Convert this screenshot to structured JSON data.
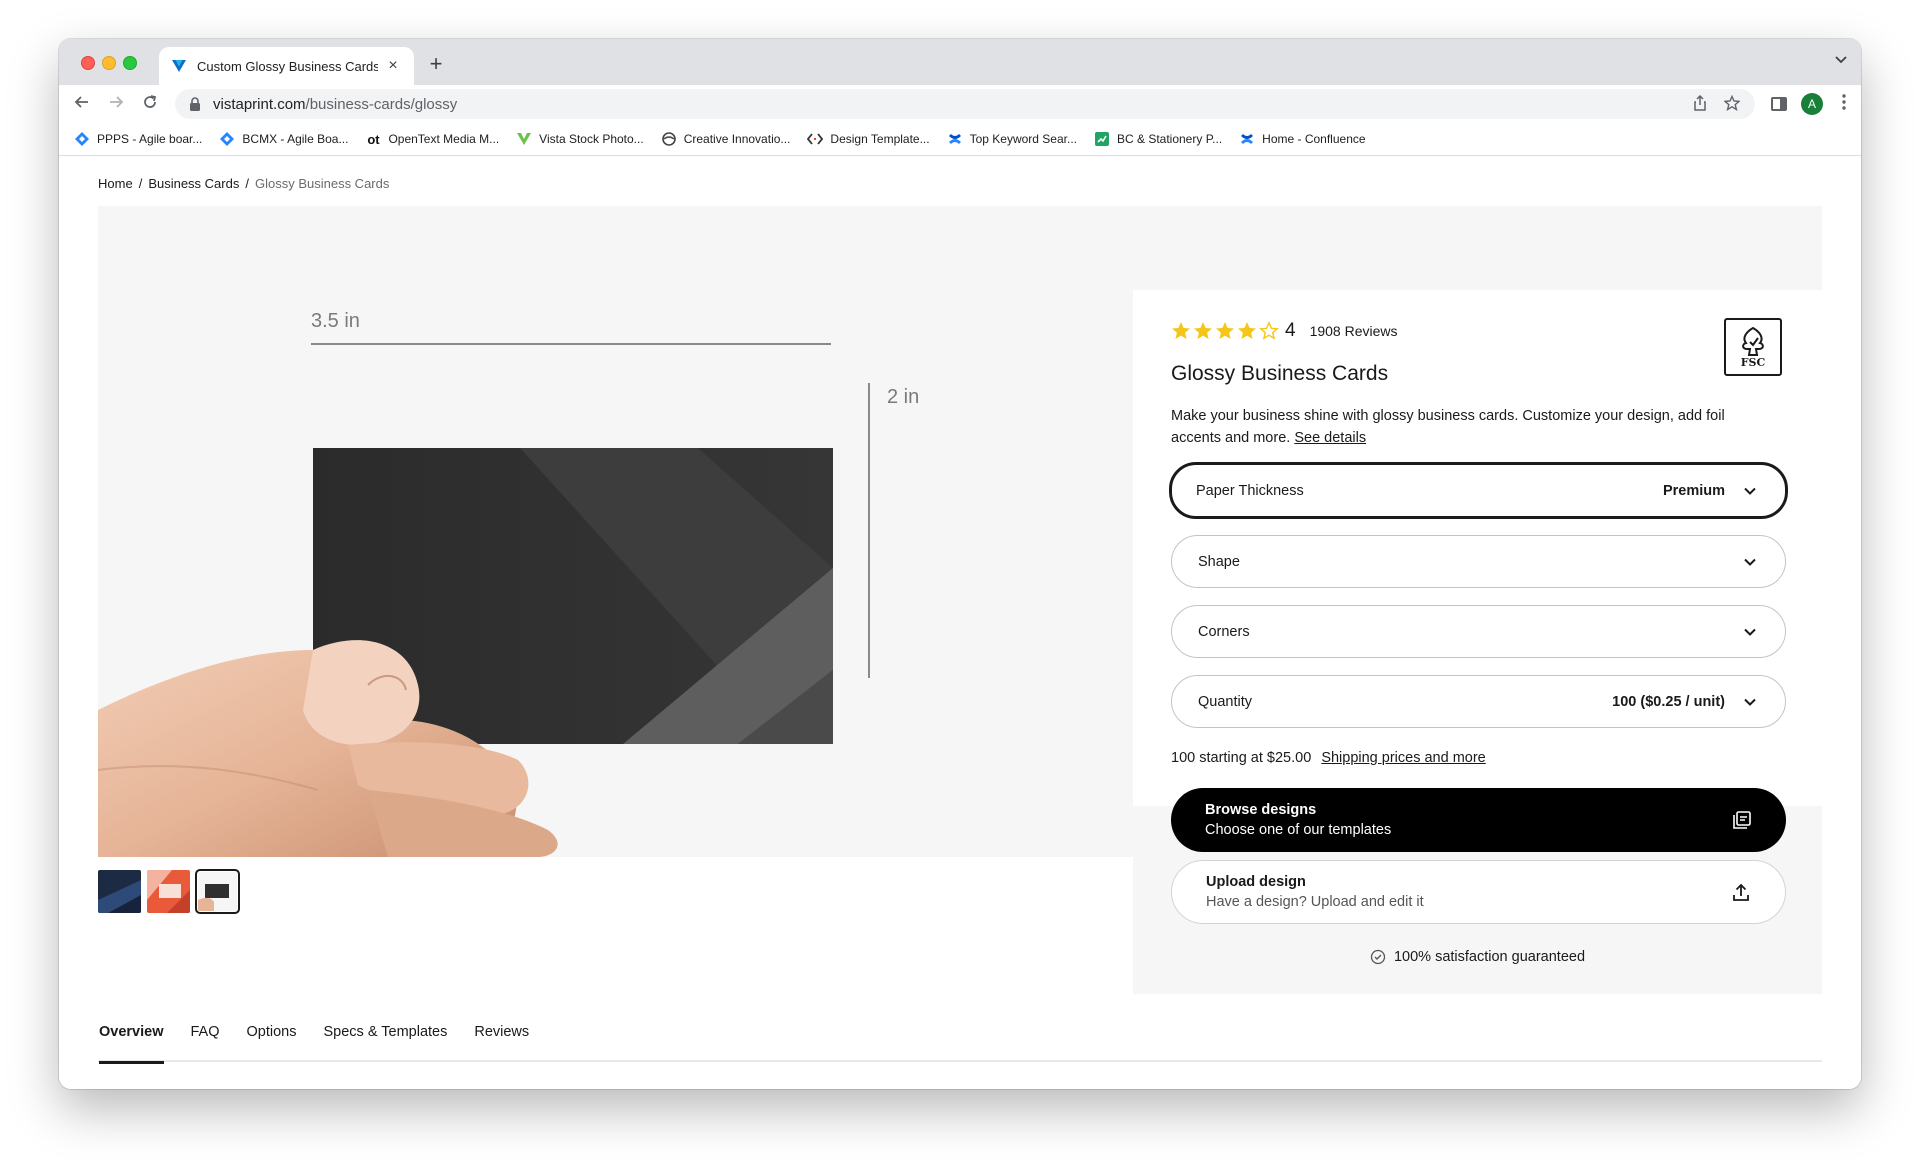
{
  "browser": {
    "tab_title": "Custom Glossy Business Cards",
    "tab_close": "×",
    "new_tab": "+",
    "url_host": "vistaprint.com",
    "url_path": "/business-cards/glossy",
    "profile_initial": "A",
    "bookmarks": [
      {
        "label": "PPPS - Agile boar...",
        "icon": "jira-diamond-icon"
      },
      {
        "label": "BCMX - Agile Boa...",
        "icon": "jira-diamond-icon"
      },
      {
        "label": "OpenText Media M...",
        "icon": "opentext-icon"
      },
      {
        "label": "Vista Stock Photo...",
        "icon": "vista-icon"
      },
      {
        "label": "Creative Innovatio...",
        "icon": "globe-icon"
      },
      {
        "label": "Design Template...",
        "icon": "code-icon"
      },
      {
        "label": "Top Keyword Sear...",
        "icon": "confluence-icon"
      },
      {
        "label": "BC & Stationery P...",
        "icon": "chart-icon"
      },
      {
        "label": "Home - Confluence",
        "icon": "confluence-icon"
      }
    ]
  },
  "breadcrumb": {
    "home": "Home",
    "sep1": "/",
    "category": "Business Cards",
    "sep2": "/",
    "current": "Glossy Business Cards"
  },
  "image": {
    "width_label": "3.5 in",
    "height_label": "2 in"
  },
  "product": {
    "rating": 4,
    "rating_label": "4",
    "reviews": "1908 Reviews",
    "fsc": "FSC",
    "title": "Glossy Business Cards",
    "description": "Make your business shine with glossy business cards. Customize your design, add foil accents and more.",
    "details_link": "See details"
  },
  "options": {
    "paper_thickness": {
      "label": "Paper Thickness",
      "value": "Premium"
    },
    "shape": {
      "label": "Shape",
      "value": ""
    },
    "corners": {
      "label": "Corners",
      "value": ""
    },
    "quantity": {
      "label": "Quantity",
      "value": "100 ($0.25 / unit)"
    }
  },
  "pricing": {
    "starting": "100 starting at $25.00",
    "shipping_link": "Shipping prices and more"
  },
  "actions": {
    "browse_title": "Browse designs",
    "browse_sub": "Choose one of our templates",
    "upload_title": "Upload design",
    "upload_sub": "Have a design? Upload and edit it"
  },
  "guarantee": "100% satisfaction guaranteed",
  "bottom_tabs": [
    "Overview",
    "FAQ",
    "Options",
    "Specs & Templates",
    "Reviews"
  ],
  "colors": {
    "accent": "#000000",
    "star": "#f5c518",
    "panel_bg": "#f6f6f6"
  }
}
